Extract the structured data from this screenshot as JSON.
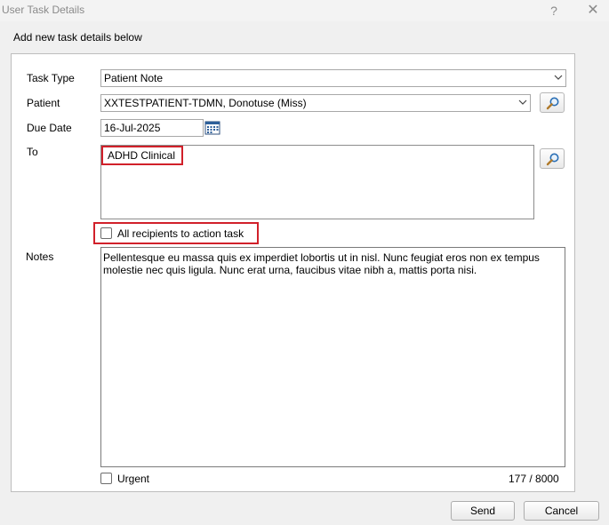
{
  "window": {
    "title": "User Task Details",
    "help": "?",
    "close": "✕"
  },
  "subtitle": "Add new task details below",
  "form": {
    "task_type_label": "Task Type",
    "task_type_value": "Patient Note",
    "patient_label": "Patient",
    "patient_value": "XXTESTPATIENT-TDMN, Donotuse (Miss)",
    "due_date_label": "Due Date",
    "due_date_value": "16-Jul-2025",
    "to_label": "To",
    "to_recipient": "ADHD Clinical",
    "all_recipients_label": "All recipients to action task",
    "notes_label": "Notes",
    "notes_text": "Pellentesque eu massa quis ex imperdiet lobortis ut in nisl. Nunc feugiat eros non ex tempus molestie nec quis ligula. Nunc erat urna, faucibus vitae nibh a, mattis porta nisi.",
    "urgent_label": "Urgent",
    "char_count": "177 / 8000"
  },
  "buttons": {
    "send": "Send",
    "cancel": "Cancel"
  },
  "icons": {
    "search": "magnifier-icon",
    "calendar": "calendar-icon",
    "dropdown": "chevron-down-icon"
  },
  "colors": {
    "highlight": "#d1202a"
  }
}
